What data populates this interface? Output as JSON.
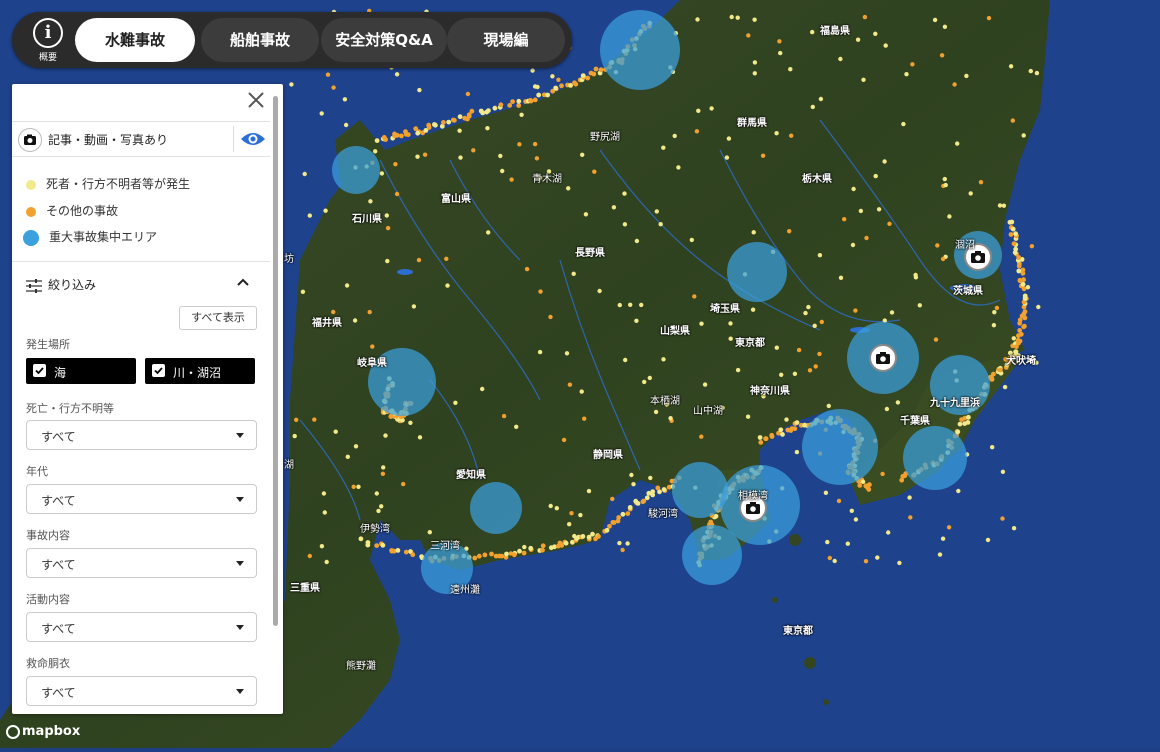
{
  "nav": {
    "info_label": "概要",
    "tabs": [
      {
        "label": "水難事故",
        "active": true
      },
      {
        "label": "船舶事故",
        "active": false
      },
      {
        "label": "安全対策Q&A",
        "active": false
      },
      {
        "label": "現場編",
        "active": false
      }
    ]
  },
  "panel": {
    "media_label": "記事・動画・写真あり",
    "legend": [
      {
        "label": "死者・行方不明者等が発生",
        "color": "#f1e98a"
      },
      {
        "label": "その他の事故",
        "color": "#f2a12e"
      },
      {
        "label": "重大事故集中エリア",
        "color": "#3aa0de"
      }
    ],
    "filter_title": "絞り込み",
    "show_all_label": "すべて表示",
    "location": {
      "label": "発生場所",
      "options": [
        {
          "label": "海",
          "checked": true
        },
        {
          "label": "川・湖沼",
          "checked": true
        }
      ]
    },
    "selects": [
      {
        "label": "死亡・行方不明等",
        "value": "すべて"
      },
      {
        "label": "年代",
        "value": "すべて"
      },
      {
        "label": "事故内容",
        "value": "すべて"
      },
      {
        "label": "活動内容",
        "value": "すべて"
      },
      {
        "label": "救命胴衣",
        "value": "すべて"
      }
    ]
  },
  "map": {
    "attribution": "mapbox",
    "labels": [
      {
        "text": "福島県",
        "bold": true
      },
      {
        "text": "群馬県",
        "bold": true
      },
      {
        "text": "栃木県",
        "bold": true
      },
      {
        "text": "野尻湖",
        "bold": false
      },
      {
        "text": "青木湖",
        "bold": false
      },
      {
        "text": "富山県",
        "bold": true
      },
      {
        "text": "石川県",
        "bold": true
      },
      {
        "text": "長野県",
        "bold": true
      },
      {
        "text": "福井県",
        "bold": true
      },
      {
        "text": "岐阜県",
        "bold": true
      },
      {
        "text": "埼玉県",
        "bold": true
      },
      {
        "text": "山梨県",
        "bold": true
      },
      {
        "text": "東京都",
        "bold": true
      },
      {
        "text": "神奈川県",
        "bold": true
      },
      {
        "text": "茨城県",
        "bold": true
      },
      {
        "text": "涸沼",
        "bold": false
      },
      {
        "text": "犬吠埼",
        "bold": true
      },
      {
        "text": "九十九里浜",
        "bold": true
      },
      {
        "text": "千葉県",
        "bold": true
      },
      {
        "text": "本栖湖",
        "bold": false
      },
      {
        "text": "山中湖",
        "bold": false
      },
      {
        "text": "静岡県",
        "bold": true
      },
      {
        "text": "愛知県",
        "bold": true
      },
      {
        "text": "伊勢湾",
        "bold": false
      },
      {
        "text": "三河湾",
        "bold": false
      },
      {
        "text": "遠州灘",
        "bold": false
      },
      {
        "text": "駿河湾",
        "bold": false
      },
      {
        "text": "相模湾",
        "bold": false
      },
      {
        "text": "三重県",
        "bold": true
      },
      {
        "text": "熊野灘",
        "bold": false
      },
      {
        "text": "東京都",
        "bold": true
      },
      {
        "text": "湖",
        "bold": false
      },
      {
        "text": "坊",
        "bold": false
      }
    ]
  }
}
